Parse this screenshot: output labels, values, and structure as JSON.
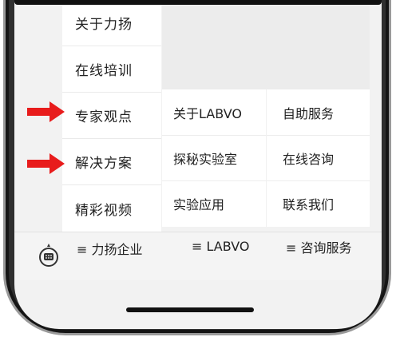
{
  "menu_primary": [
    {
      "label": "关于力扬"
    },
    {
      "label": "在线培训"
    },
    {
      "label": "专家观点"
    },
    {
      "label": "解决方案"
    },
    {
      "label": "精彩视频"
    }
  ],
  "menu_secondary": {
    "col1": [
      "关于LABVO",
      "探秘实验室",
      "实验应用"
    ],
    "col2": [
      "自助服务",
      "在线咨询",
      "联系我们"
    ]
  },
  "tabbar": {
    "tab1": "≡ 力扬企业",
    "tab2": "≡ LABVO",
    "tab3": "≡ 咨询服务",
    "chat_icon": "chat-bubble-icon"
  },
  "colors": {
    "arrow": "#e81c1c",
    "menu_bg": "#ffffff",
    "screen_bg": "#f2f2f2",
    "frame": "#2f2f2f"
  }
}
